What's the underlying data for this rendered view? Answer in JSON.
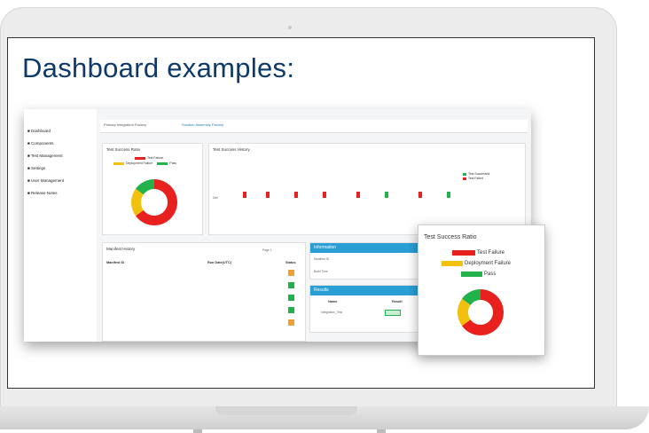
{
  "headline": "Dashboard examples:",
  "colors": {
    "failure": "#e8211f",
    "deployment_failure": "#f2c110",
    "pass": "#22b24c",
    "accent": "#1a79b8",
    "headline": "#0e3a6b"
  },
  "sidebar": {
    "items": [
      {
        "label": "Dashboard",
        "icon": "home-icon"
      },
      {
        "label": "Components",
        "icon": "cube-icon"
      },
      {
        "label": "Test Management",
        "icon": "flask-icon"
      },
      {
        "label": "Settings",
        "icon": "gear-icon"
      },
      {
        "label": "User Management",
        "icon": "users-icon"
      },
      {
        "label": "Release Notes",
        "icon": "document-icon"
      }
    ]
  },
  "tabs": [
    {
      "label": "Primary Integration Factory"
    },
    {
      "label": "Solution Assembly Factory"
    }
  ],
  "success_card": {
    "title": "Test Success Ratio",
    "legend": [
      "Test Failure",
      "Deployment Failure",
      "Pass"
    ]
  },
  "history_card": {
    "title": "Test Success History",
    "legend": [
      "Test Successful",
      "Test Failed"
    ],
    "row_label": "Cell"
  },
  "manifest_card": {
    "title": "Manifest History",
    "pager": "Page 1",
    "columns": [
      "Manifest ID",
      "Run Date(UTC)",
      "Status"
    ]
  },
  "info_card": {
    "title": "Information",
    "rows": [
      "Manifest ID",
      "Build Time"
    ]
  },
  "results_card": {
    "title": "Results",
    "columns": [
      "Name",
      "Result"
    ],
    "row_name": "Integration_Test"
  },
  "popup": {
    "title": "Test Success Ratio",
    "legend": [
      "Test Failure",
      "Deployment Failure",
      "Pass"
    ]
  },
  "chart_data": {
    "type": "pie",
    "title": "Test Success Ratio",
    "categories": [
      "Test Failure",
      "Deployment Failure",
      "Pass"
    ],
    "values": [
      65,
      20,
      15
    ]
  }
}
